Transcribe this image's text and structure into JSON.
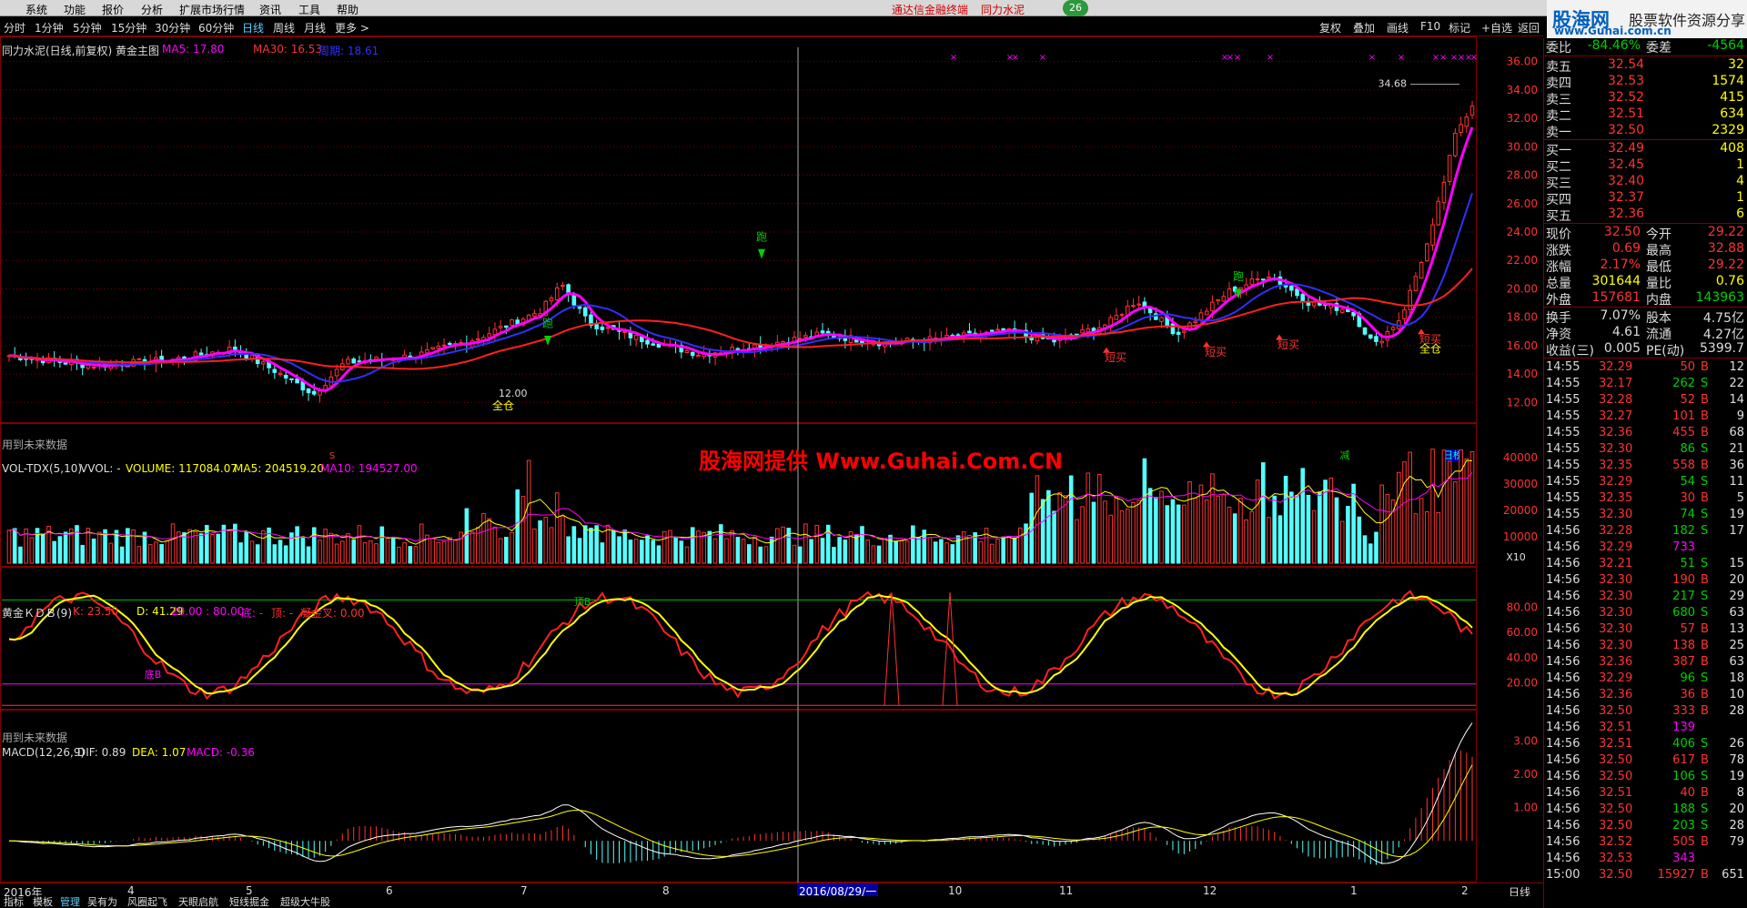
{
  "menu": {
    "items": [
      "系统",
      "功能",
      "报价",
      "分析",
      "扩展市场行情",
      "资讯",
      "工具",
      "帮助"
    ],
    "promo1": "通达信金融终端",
    "promo2": "同力水泥",
    "badge": "26"
  },
  "logo": {
    "brand": "股海网",
    "tagline": "股票软件资源分享",
    "url": "www.Guhai.com.cn"
  },
  "periods": [
    "分时",
    "1分钟",
    "5分钟",
    "15分钟",
    "30分钟",
    "60分钟",
    "日线",
    "周线",
    "月线",
    "更多 >"
  ],
  "active_period": "日线",
  "toolbar": [
    "复权",
    "叠加",
    "画线",
    "F10",
    "标记",
    "+自选",
    "返回"
  ],
  "main_panel": {
    "title": "同力水泥(日线,前复权) 黄金主图",
    "ma5": "MA5: 17.80",
    "ma30": "MA30: 16.53",
    "ma_blue": "周期: 18.61",
    "note": "用到未来数据",
    "high_label": "34.68",
    "low_label": "12.00",
    "y_ticks": [
      "36.00",
      "34.00",
      "32.00",
      "30.00",
      "28.00",
      "26.00",
      "24.00",
      "22.00",
      "20.00",
      "18.00",
      "16.00",
      "14.00",
      "12.00"
    ],
    "signals": {
      "run": "跑",
      "full": "全仓",
      "short_buy": "短买",
      "reduce": "减",
      "day_rank": "日榜"
    }
  },
  "vol_panel": {
    "title": "VOL-TDX(5,10)",
    "vvol": "VVOL: -",
    "volume": "VOLUME: 117084.07",
    "ma5": "MA5: 204519.20",
    "ma10": "MA10: 194527.00",
    "y_ticks": [
      "40000",
      "30000",
      "20000",
      "10000"
    ],
    "unit": "X10"
  },
  "kdb_panel": {
    "title": "黄金ＫＤＢ(9)",
    "k": "K: 23.50",
    "d": "D: 41.29",
    "lines": "20.00 : 80.00",
    "bottom": "底: -",
    "top": "顶: -",
    "cross": "凝金叉: 0.00",
    "note": "用到未来数据",
    "top_label": "顶B",
    "bottom_label": "底B",
    "y_ticks": [
      "80.00",
      "60.00",
      "40.00",
      "20.00"
    ]
  },
  "macd_panel": {
    "title": "MACD(12,26,9)",
    "dif": "DIF: 0.89",
    "dea": "DEA: 1.07",
    "macd": "MACD: -0.36",
    "y_ticks": [
      "3.00",
      "2.00",
      "1.00"
    ]
  },
  "x_axis": {
    "labels": [
      "2016年",
      "4",
      "5",
      "6",
      "7",
      "8",
      "10",
      "11",
      "12",
      "1",
      "2"
    ],
    "cursor": "2016/08/29/一",
    "period": "日线"
  },
  "watermark": "股海网提供 Www.Guhai.Com.CN",
  "bottom_tabs": [
    "指标",
    "模板",
    "管理",
    "吴有为",
    "风圈起飞",
    "天眼启航",
    "短线掘金",
    "超级大牛股"
  ],
  "quote": {
    "commit": {
      "label1": "委比",
      "v1": "-84.46%",
      "label2": "委差",
      "v2": "-4564"
    },
    "asks": [
      {
        "label": "卖五",
        "price": "32.54",
        "vol": "32"
      },
      {
        "label": "卖四",
        "price": "32.53",
        "vol": "1574"
      },
      {
        "label": "卖三",
        "price": "32.52",
        "vol": "415"
      },
      {
        "label": "卖二",
        "price": "32.51",
        "vol": "634"
      },
      {
        "label": "卖一",
        "price": "32.50",
        "vol": "2329"
      }
    ],
    "bids": [
      {
        "label": "买一",
        "price": "32.49",
        "vol": "408"
      },
      {
        "label": "买二",
        "price": "32.45",
        "vol": "1"
      },
      {
        "label": "买三",
        "price": "32.40",
        "vol": "4"
      },
      {
        "label": "买四",
        "price": "32.37",
        "vol": "1"
      },
      {
        "label": "买五",
        "price": "32.36",
        "vol": "6"
      }
    ],
    "stats": [
      {
        "l1": "现价",
        "v1": "32.50",
        "l2": "今开",
        "v2": "29.22"
      },
      {
        "l1": "涨跌",
        "v1": "0.69",
        "l2": "最高",
        "v2": "32.88"
      },
      {
        "l1": "涨幅",
        "v1": "2.17%",
        "l2": "最低",
        "v2": "29.22"
      },
      {
        "l1": "总量",
        "v1": "301644",
        "l2": "量比",
        "v2": "0.76"
      },
      {
        "l1": "外盘",
        "v1": "157681",
        "l2": "内盘",
        "v2": "143963"
      }
    ],
    "stats2": [
      {
        "l1": "换手",
        "v1": "7.07%",
        "l2": "股本",
        "v2": "4.75亿"
      },
      {
        "l1": "净资",
        "v1": "4.61",
        "l2": "流通",
        "v2": "4.27亿"
      },
      {
        "l1": "收益(三)",
        "v1": "0.005",
        "l2": "PE(动)",
        "v2": "5399.7"
      }
    ],
    "ticks": [
      [
        "14:55",
        "32.29",
        "50",
        "B",
        "12"
      ],
      [
        "14:55",
        "32.17",
        "262",
        "S",
        "22"
      ],
      [
        "14:55",
        "32.28",
        "52",
        "B",
        "14"
      ],
      [
        "14:55",
        "32.27",
        "101",
        "B",
        "9"
      ],
      [
        "14:55",
        "32.36",
        "455",
        "B",
        "68"
      ],
      [
        "14:55",
        "32.30",
        "86",
        "S",
        "21"
      ],
      [
        "14:55",
        "32.35",
        "558",
        "B",
        "36"
      ],
      [
        "14:55",
        "32.29",
        "54",
        "S",
        "11"
      ],
      [
        "14:55",
        "32.35",
        "30",
        "B",
        "5"
      ],
      [
        "14:55",
        "32.30",
        "74",
        "S",
        "19"
      ],
      [
        "14:56",
        "32.28",
        "182",
        "S",
        "17"
      ],
      [
        "14:56",
        "32.29",
        "733",
        "",
        ""
      ],
      [
        "14:56",
        "32.21",
        "51",
        "S",
        "15"
      ],
      [
        "14:56",
        "32.30",
        "190",
        "B",
        "20"
      ],
      [
        "14:56",
        "32.30",
        "217",
        "S",
        "29"
      ],
      [
        "14:56",
        "32.30",
        "680",
        "S",
        "63"
      ],
      [
        "14:56",
        "32.30",
        "57",
        "B",
        "13"
      ],
      [
        "14:56",
        "32.30",
        "138",
        "B",
        "25"
      ],
      [
        "14:56",
        "32.36",
        "387",
        "B",
        "63"
      ],
      [
        "14:56",
        "32.29",
        "96",
        "S",
        "18"
      ],
      [
        "14:56",
        "32.36",
        "36",
        "B",
        "10"
      ],
      [
        "14:56",
        "32.50",
        "333",
        "B",
        "28"
      ],
      [
        "14:56",
        "32.51",
        "139",
        "",
        ""
      ],
      [
        "14:56",
        "32.51",
        "406",
        "S",
        "26"
      ],
      [
        "14:56",
        "32.50",
        "617",
        "B",
        "78"
      ],
      [
        "14:56",
        "32.50",
        "106",
        "S",
        "19"
      ],
      [
        "14:56",
        "32.51",
        "40",
        "B",
        "8"
      ],
      [
        "14:56",
        "32.50",
        "188",
        "S",
        "20"
      ],
      [
        "14:56",
        "32.50",
        "203",
        "S",
        "28"
      ],
      [
        "14:56",
        "32.52",
        "505",
        "B",
        "79"
      ],
      [
        "14:56",
        "32.53",
        "343",
        "",
        ""
      ],
      [
        "15:00",
        "32.50",
        "15927",
        "B",
        "651"
      ]
    ]
  },
  "colors": {
    "up": "#ff3232",
    "down": "#54ffff",
    "ma_magenta": "#ff00ff",
    "ma_red": "#ff2020",
    "ma_blue": "#3030ff",
    "k_line": "#ff2020",
    "d_line": "#ffff00",
    "grid": "#800000"
  }
}
